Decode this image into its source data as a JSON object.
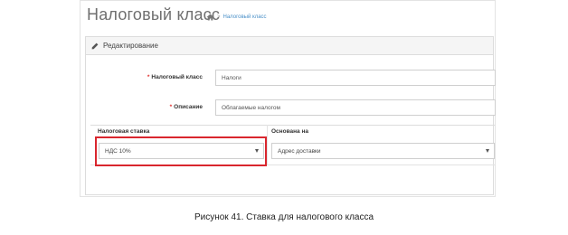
{
  "header": {
    "title": "Налоговый класс",
    "breadcrumb": {
      "home_icon": "home-icon",
      "separator": ">",
      "item": "Налоговый класс"
    }
  },
  "panel": {
    "icon": "pencil-icon",
    "title": "Редактирование"
  },
  "form": {
    "tax_class": {
      "label": "Налоговый класс",
      "required_mark": "*",
      "value": "Налоги"
    },
    "description": {
      "label": "Описание",
      "required_mark": "*",
      "value": "Облагаемые налогом"
    }
  },
  "rates_table": {
    "headers": [
      "Налоговая ставка",
      "Основана на"
    ],
    "rows": [
      {
        "rate": "НДС 10%",
        "based_on": "Адрес доставки"
      }
    ]
  },
  "highlight_color": "#d9262e",
  "caption": "Рисунок 41. Ставка для налогового класса"
}
